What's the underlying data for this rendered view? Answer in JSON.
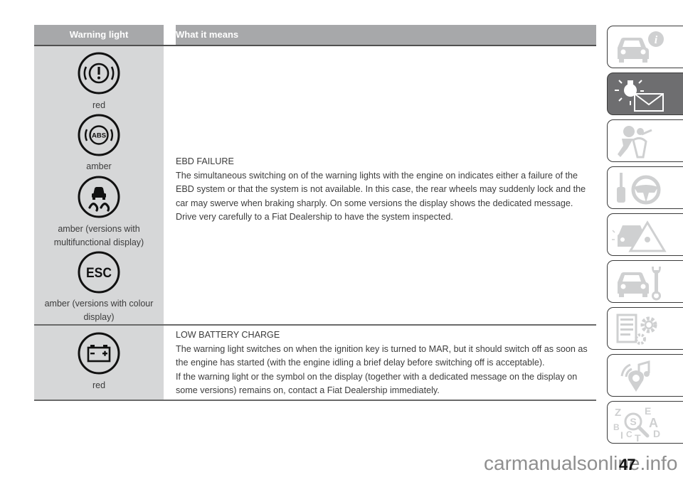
{
  "table": {
    "headers": {
      "warning_light": "Warning light",
      "what_it_means": "What it means"
    },
    "rows": [
      {
        "lights": [
          {
            "icon": "brake-warning-icon",
            "caption": "red"
          },
          {
            "icon": "abs-icon",
            "caption": "amber",
            "glyph_text": "ABS"
          },
          {
            "icon": "skid-car-icon",
            "caption": "amber (versions with multifunctional display)"
          },
          {
            "icon": "esc-icon",
            "caption": "amber (versions with colour display)",
            "glyph_text": "ESC"
          }
        ],
        "title": "EBD FAILURE",
        "paragraphs": [
          "The simultaneous switching on of the warning lights with the engine on indicates either a failure of the EBD system or that the system is not available. In this case, the rear wheels may suddenly lock and the car may swerve when braking sharply. On some versions the display shows the dedicated message.",
          "Drive very carefully to a Fiat Dealership to have the system inspected."
        ]
      },
      {
        "lights": [
          {
            "icon": "battery-icon",
            "caption": "red"
          }
        ],
        "title": "LOW BATTERY CHARGE",
        "paragraphs": [
          "The warning light switches on when the ignition key is turned to MAR, but it should switch off as soon as the engine has started (with the engine idling a brief delay before switching off is acceptable).",
          "If the warning light or the symbol on the display (together with a dedicated message on the display on some versions) remains on, contact a Fiat Dealership immediately."
        ]
      }
    ]
  },
  "side_tabs": [
    {
      "name": "car-info",
      "icon": "car-info-icon",
      "active": false
    },
    {
      "name": "warning-lights-messages",
      "icon": "warning-light-message-icon",
      "active": true
    },
    {
      "name": "safety",
      "icon": "airbag-passenger-icon",
      "active": false
    },
    {
      "name": "starting-driving",
      "icon": "key-steering-wheel-icon",
      "active": false
    },
    {
      "name": "emergency",
      "icon": "car-hazard-icon",
      "active": false
    },
    {
      "name": "servicing",
      "icon": "car-wrench-icon",
      "active": false
    },
    {
      "name": "technical-data",
      "icon": "list-gears-icon",
      "active": false
    },
    {
      "name": "multimedia",
      "icon": "music-location-icon",
      "active": false
    },
    {
      "name": "index",
      "icon": "alphabet-search-icon",
      "active": false,
      "letters": [
        "Z",
        "E",
        "B",
        "A",
        "C",
        "D",
        "T",
        "I"
      ]
    }
  ],
  "colors": {
    "header_bg": "#a7a8aa",
    "left_col_bg": "#d6d7d8",
    "active_tab_bg": "#6e6e70",
    "icon_inactive": "#cfd0d1"
  },
  "page_number": "47",
  "watermark": "carmanualsonline.info"
}
